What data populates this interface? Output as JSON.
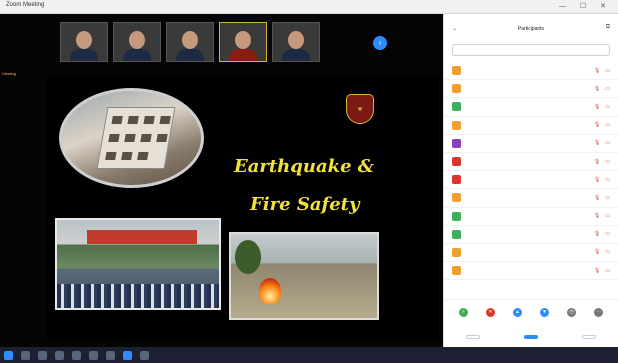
{
  "window": {
    "title": "Zoom Meeting",
    "controls": "— ☐ ✕"
  },
  "gallery": {
    "participants": [
      {
        "name": "",
        "active": false,
        "tone": "dark"
      },
      {
        "name": "",
        "active": false,
        "tone": "dark"
      },
      {
        "name": "",
        "active": false,
        "tone": "dark"
      },
      {
        "name": "",
        "active": true,
        "tone": "red"
      },
      {
        "name": "",
        "active": false,
        "tone": "dark"
      }
    ],
    "next_icon": "chevron-right-icon",
    "share_label": "Viewing"
  },
  "slide": {
    "title_line1": "Earthquake &",
    "title_line2": "Fire Safety",
    "caption_date": "",
    "caption_school": "",
    "caption_location": ""
  },
  "panel": {
    "title": "Participants",
    "search_placeholder": "",
    "participants": [
      {
        "initial": "",
        "color": "#f0a030",
        "name": ""
      },
      {
        "initial": "",
        "color": "#f0a030",
        "name": ""
      },
      {
        "initial": "",
        "color": "#3fae5a",
        "name": ""
      },
      {
        "initial": "",
        "color": "#f0a030",
        "name": ""
      },
      {
        "initial": "",
        "color": "#8a3fbf",
        "name": ""
      },
      {
        "initial": "",
        "color": "#d9372c",
        "name": ""
      },
      {
        "initial": "",
        "color": "#d9372c",
        "name": ""
      },
      {
        "initial": "",
        "color": "#f0a030",
        "name": ""
      },
      {
        "initial": "",
        "color": "#3fae5a",
        "name": ""
      },
      {
        "initial": "",
        "color": "#3fae5a",
        "name": ""
      },
      {
        "initial": "",
        "color": "#f0a030",
        "name": ""
      },
      {
        "initial": "",
        "color": "#f0a030",
        "name": ""
      }
    ],
    "reactions": [
      {
        "icon": "check-icon",
        "color": "#3fae5a",
        "label": ""
      },
      {
        "icon": "x-icon",
        "color": "#d9372c",
        "label": ""
      },
      {
        "icon": "up-icon",
        "color": "#2d8cff",
        "label": ""
      },
      {
        "icon": "down-icon",
        "color": "#2d8cff",
        "label": ""
      },
      {
        "icon": "clock-icon",
        "color": "#777777",
        "label": ""
      },
      {
        "icon": "more-icon",
        "color": "#777777",
        "label": ""
      }
    ],
    "buttons": {
      "invite": "",
      "mute_all": "",
      "more": ""
    }
  },
  "taskbar": {
    "time": "",
    "date": ""
  }
}
